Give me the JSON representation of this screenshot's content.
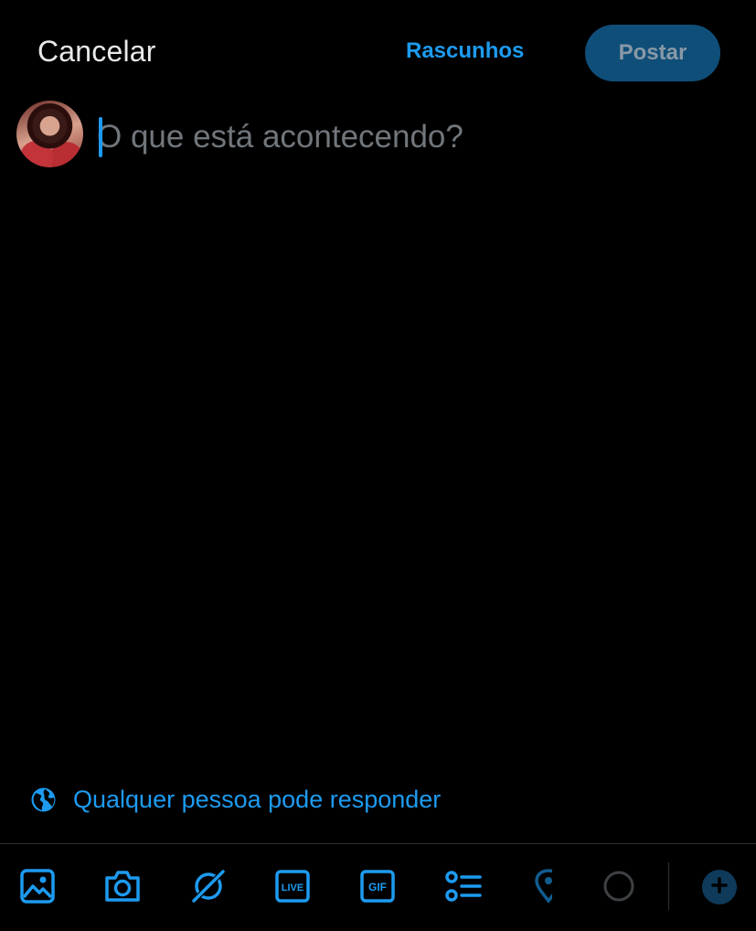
{
  "header": {
    "cancel_label": "Cancelar",
    "drafts_label": "Rascunhos",
    "post_label": "Postar"
  },
  "composer": {
    "placeholder": "O que está acontecendo?",
    "value": ""
  },
  "reply_setting": {
    "label": "Qualquer pessoa pode responder",
    "icon": "globe-icon"
  },
  "toolbar": {
    "items": [
      {
        "name": "image-icon"
      },
      {
        "name": "camera-icon"
      },
      {
        "name": "grok-icon"
      },
      {
        "name": "live-icon",
        "text": "LIVE"
      },
      {
        "name": "gif-icon",
        "text": "GIF"
      },
      {
        "name": "poll-icon"
      },
      {
        "name": "location-icon"
      },
      {
        "name": "character-count-circle"
      },
      {
        "name": "add-post-icon"
      }
    ]
  },
  "colors": {
    "background": "#000000",
    "accent": "#1d9bf0",
    "post_button_bg": "#0f4e78",
    "post_button_text": "#8899a6",
    "placeholder": "#71767b",
    "text": "#e7e9ea",
    "divider": "#2f3336"
  }
}
